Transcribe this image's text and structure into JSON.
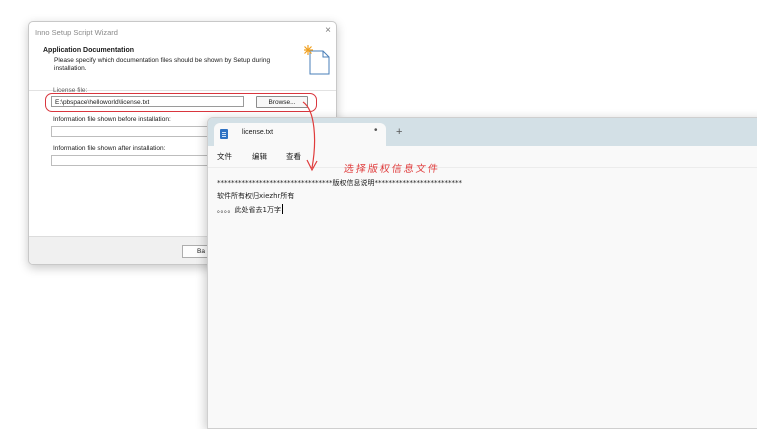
{
  "wizard": {
    "title": "Inno Setup Script Wizard",
    "close_glyph": "×",
    "heading": "Application Documentation",
    "description": "Please specify which documentation files should be shown by Setup during installation.",
    "license_label": "License file:",
    "license_value": "E:\\pbspace\\helloworld\\license.txt",
    "browse_label": "Browse...",
    "before_label": "Information file shown before installation:",
    "before_value": "",
    "after_label": "Information file shown after installation:",
    "after_value": "",
    "back_label": "Ba",
    "icon": "document-sparkle-icon"
  },
  "notepad": {
    "tab_title": "license.txt",
    "tab_dot": "•",
    "new_tab": "+",
    "menu": {
      "file": "文件",
      "edit": "编辑",
      "view": "查看"
    },
    "lines": [
      "*********************************版权信息说明*************************",
      "软件所有权归xiezhr所有",
      "。。。。此处省去1万字"
    ]
  },
  "annotation": {
    "text": "选择版权信息文件",
    "color": "#e03c3c"
  }
}
